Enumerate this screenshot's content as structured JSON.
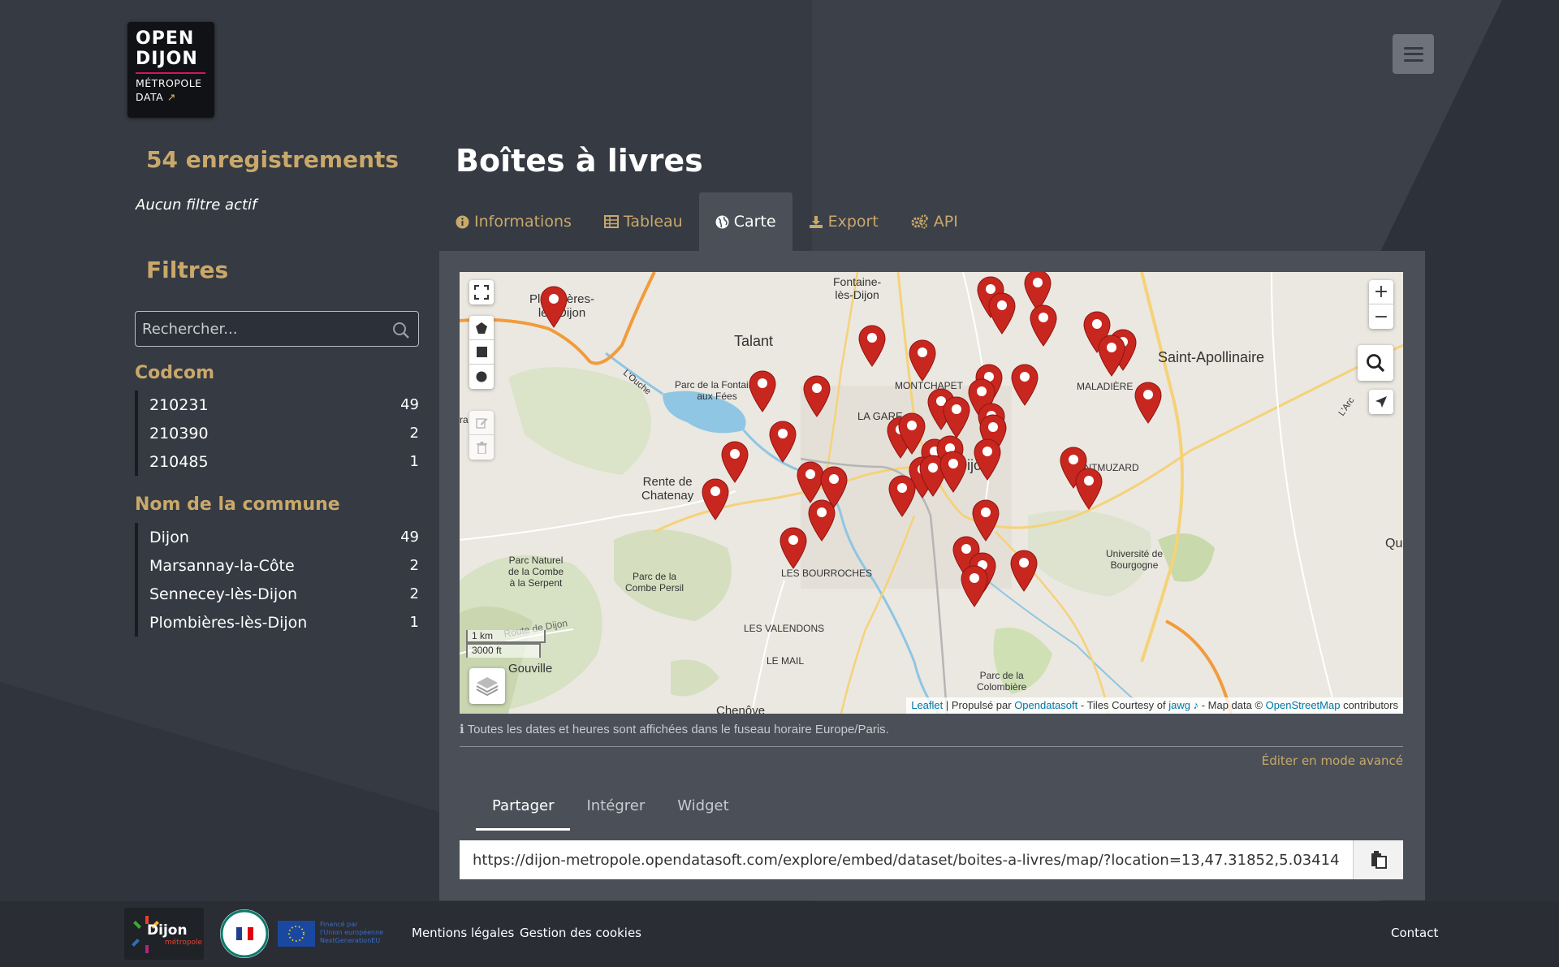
{
  "header": {
    "logo": {
      "line1": "OPEN",
      "line2": "DIJON",
      "line3": "MÉTROPOLE",
      "line4": "DATA"
    }
  },
  "sidebar": {
    "records": "54 enregistrements",
    "no_filter": "Aucun filtre actif",
    "filters_title": "Filtres",
    "search_placeholder": "Rechercher...",
    "facets": [
      {
        "title": "Codcom",
        "items": [
          {
            "label": "210231",
            "count": "49"
          },
          {
            "label": "210390",
            "count": "2"
          },
          {
            "label": "210485",
            "count": "1"
          }
        ]
      },
      {
        "title": "Nom de la commune",
        "items": [
          {
            "label": "Dijon",
            "count": "49"
          },
          {
            "label": "Marsannay-la-Côte",
            "count": "2"
          },
          {
            "label": "Sennecey-lès-Dijon",
            "count": "2"
          },
          {
            "label": "Plombières-lès-Dijon",
            "count": "1"
          }
        ]
      }
    ]
  },
  "main": {
    "title": "Boîtes à livres",
    "tabs": [
      {
        "label": "Informations",
        "icon": "info-circle-icon",
        "active": false
      },
      {
        "label": "Tableau",
        "icon": "table-icon",
        "active": false
      },
      {
        "label": "Carte",
        "icon": "globe-icon",
        "active": true
      },
      {
        "label": "Export",
        "icon": "download-icon",
        "active": false
      },
      {
        "label": "API",
        "icon": "cogs-icon",
        "active": false
      }
    ],
    "map": {
      "labels": {
        "plombieres": "Plombières-\nlès-Dijon",
        "fontaine": "Fontaine-\nlès-Dijon",
        "talant": "Talant",
        "saint_apollinaire": "Saint-Apollinaire",
        "parc_fontaine": "Parc de la Fontaine\naux Fées",
        "montchapet": "MONTCHAPET",
        "la_gare": "LA GARE",
        "maladiere": "MALADIÈRE",
        "dijon": "Dijon",
        "rente_chatenay": "Rente de\nChatenay",
        "montmuzard": "MONTMUZARD",
        "universite": "Université de\nBourgogne",
        "parc_serpent": "Parc Naturel\nde la Combe\nà la Serpent",
        "parc_persil": "Parc de la\nCombe Persil",
        "bourroches": "LES BOURROCHES",
        "valendons": "LES VALENDONS",
        "le_mail": "LE MAIL",
        "gouville": "Gouville",
        "chenove": "Chenôve",
        "colombiere": "Parc de la\nColombière",
        "ouche": "L'Ouche",
        "arc": "L'Arc",
        "route_dijon": "Route de Dijon",
        "qu": "Qu",
        "ra": "ra"
      },
      "scale": {
        "metric": "1 km",
        "imperial": "3000 ft"
      },
      "zoom_in": "+",
      "zoom_out": "−",
      "attribution": {
        "leaflet": "Leaflet",
        "sep1": " | Propulsé par ",
        "ods": "Opendatasoft",
        "sep2": " - Tiles Courtesy of ",
        "jawg": "jawg",
        "sep3": " - Map data © ",
        "osm": "OpenStreetMap",
        "sep4": " contributors"
      },
      "marker_color": "#c8271f"
    },
    "timezone_note": "Toutes les dates et heures sont affichées dans le fuseau horaire Europe/Paris.",
    "edit_advanced": "Éditer en mode avancé",
    "share_tabs": [
      {
        "label": "Partager",
        "active": true
      },
      {
        "label": "Intégrer",
        "active": false
      },
      {
        "label": "Widget",
        "active": false
      }
    ],
    "embed_url": "https://dijon-metropole.opendatasoft.com/explore/embed/dataset/boites-a-livres/map/?location=13,47.31852,5.03414"
  },
  "footer": {
    "links": {
      "legal": "Mentions légales",
      "cookies": "Gestion des cookies",
      "contact": "Contact"
    },
    "logo_dijon": "Dijon",
    "logo_dijon_sub": "métropole",
    "eu_text": "Financé par\nl'Union européenne\nNextGenerationEU"
  }
}
